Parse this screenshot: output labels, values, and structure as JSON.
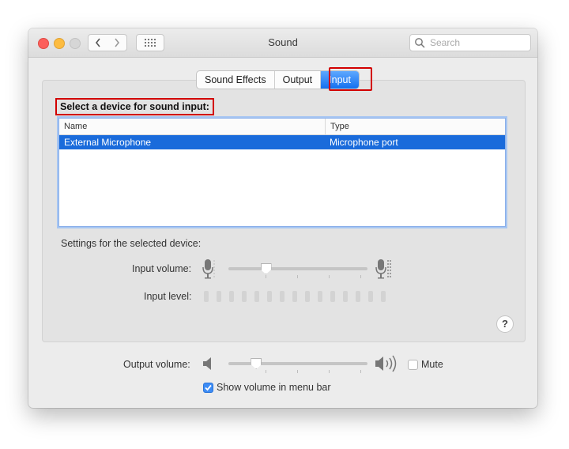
{
  "window": {
    "title": "Sound",
    "search_placeholder": "Search"
  },
  "tabs": [
    {
      "label": "Sound Effects",
      "active": false
    },
    {
      "label": "Output",
      "active": false
    },
    {
      "label": "Input",
      "active": true
    }
  ],
  "input_section": {
    "heading": "Select a device for sound input:",
    "table": {
      "columns": [
        "Name",
        "Type"
      ],
      "rows": [
        {
          "name": "External Microphone",
          "type": "Microphone port",
          "selected": true
        }
      ]
    },
    "settings_label": "Settings for the selected device:",
    "input_volume_label": "Input volume:",
    "input_volume_fraction": 0.27,
    "input_level_label": "Input level:",
    "help_label": "?"
  },
  "output": {
    "volume_label": "Output volume:",
    "volume_fraction": 0.2,
    "mute_label": "Mute",
    "mute_checked": false,
    "show_volume_label": "Show volume in menu bar",
    "show_volume_checked": true
  },
  "colors": {
    "accent": "#1a6bdb",
    "highlight_box": "#d20000"
  }
}
